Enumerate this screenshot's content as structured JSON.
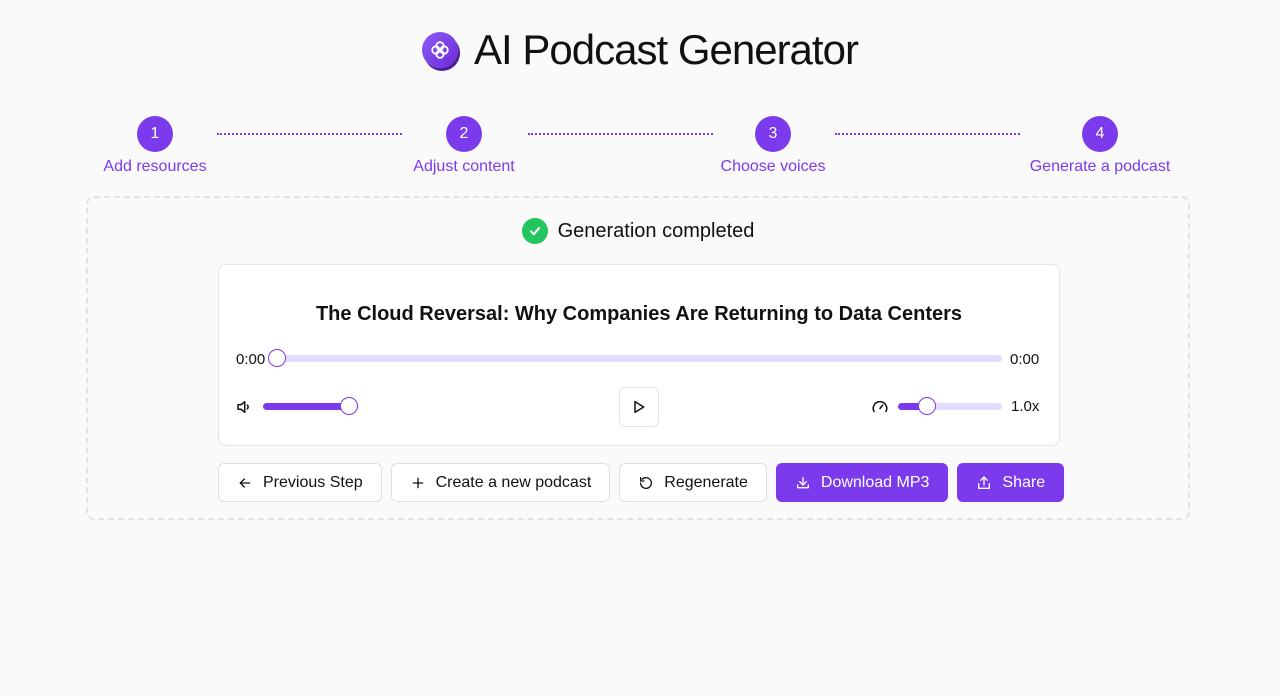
{
  "app": {
    "title": "AI Podcast Generator",
    "accent": "#7c3aed",
    "success": "#22c55e"
  },
  "steps": [
    {
      "number": "1",
      "label": "Add resources"
    },
    {
      "number": "2",
      "label": "Adjust content"
    },
    {
      "number": "3",
      "label": "Choose voices"
    },
    {
      "number": "4",
      "label": "Generate a podcast"
    }
  ],
  "status": {
    "text": "Generation completed",
    "icon": "check-circle-icon"
  },
  "player": {
    "episode_title": "The Cloud Reversal: Why Companies Are Returning to Data Centers",
    "current_time": "0:00",
    "duration": "0:00",
    "progress": 0,
    "volume": 0.9,
    "playback_rate_label": "1.0x",
    "playback_rate_fraction": 0.28
  },
  "actions": {
    "previous": "Previous Step",
    "create_new": "Create a new podcast",
    "regenerate": "Regenerate",
    "download": "Download MP3",
    "share": "Share"
  }
}
